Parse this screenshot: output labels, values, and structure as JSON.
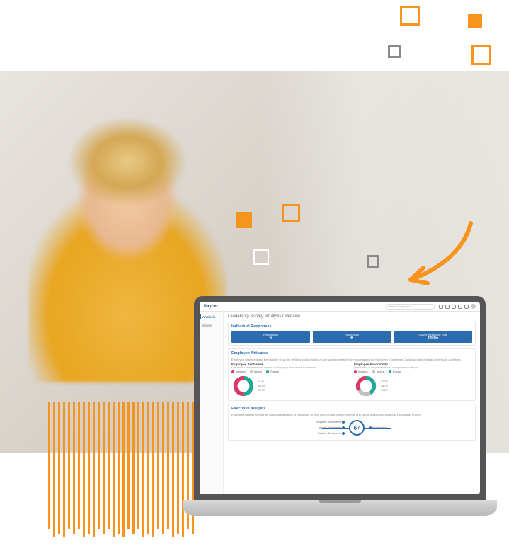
{
  "header": {
    "logo": "Paycor",
    "search_placeholder": "Search Employee"
  },
  "sidebar": {
    "items": [
      {
        "label": "Analysis"
      },
      {
        "label": "Survey"
      }
    ]
  },
  "page_title": "Leadership Survey: Analysis Overview",
  "individual_responses": {
    "title": "Individual Responses",
    "stats": [
      {
        "label": "Participants",
        "value": "6"
      },
      {
        "label": "Responses",
        "value": "6"
      },
      {
        "label": "Survey Response Rate",
        "value": "100%"
      }
    ]
  },
  "employee_attitudes": {
    "title": "Employee Attitudes",
    "subtitle": "Employee Sentiment and Favorability show the feelings and opinions of your workforce based on responses to the Employee Experience Continuum and Rating/Likert-Scale questions.",
    "sentiment": {
      "title": "Employee Sentiment",
      "sub": "Distribution of submissions based on Employee Experience Continuum",
      "legend": [
        {
          "label": "Negative"
        },
        {
          "label": "Neutral"
        },
        {
          "label": "Positive"
        }
      ],
      "side_labels": [
        {
          "text": "0.0%"
        },
        {
          "text": "50.0%"
        },
        {
          "text": "50.0%"
        }
      ]
    },
    "favorability": {
      "title": "Employee Favorability",
      "sub": "Distribution of responses based on agreement ratings",
      "legend": [
        {
          "label": "Negative"
        },
        {
          "label": "Neutral"
        },
        {
          "label": "Positive"
        }
      ],
      "side_labels": [
        {
          "text": "33.3%"
        },
        {
          "text": "25.7%"
        },
        {
          "text": "41.0%"
        }
      ]
    }
  },
  "executive_insights": {
    "title": "Executive Insights",
    "subtitle": "Executive Insights provide an illustrative analysis of responses to both open-ended direct-response and rating questions provided in Leadership Survey.",
    "center_value": "67",
    "nodes_left": [
      {
        "label": "Negative Sentiments"
      },
      {
        "label": "Neutral Sentiments"
      },
      {
        "label": "Positive Sentiments"
      }
    ],
    "nodes_right": [
      {
        "label": "Participation"
      }
    ]
  },
  "chart_data": [
    {
      "type": "pie",
      "title": "Employee Sentiment",
      "series": [
        {
          "name": "Negative",
          "value": 0.0,
          "color": "#d73964"
        },
        {
          "name": "Neutral",
          "value": 50.0,
          "color": "#bfbfbf"
        },
        {
          "name": "Positive",
          "value": 50.0,
          "color": "#1fa896"
        }
      ]
    },
    {
      "type": "pie",
      "title": "Employee Favorability",
      "series": [
        {
          "name": "Negative",
          "value": 33.3,
          "color": "#d73964"
        },
        {
          "name": "Neutral",
          "value": 25.7,
          "color": "#bfbfbf"
        },
        {
          "name": "Positive",
          "value": 41.0,
          "color": "#1fa896"
        }
      ]
    }
  ]
}
